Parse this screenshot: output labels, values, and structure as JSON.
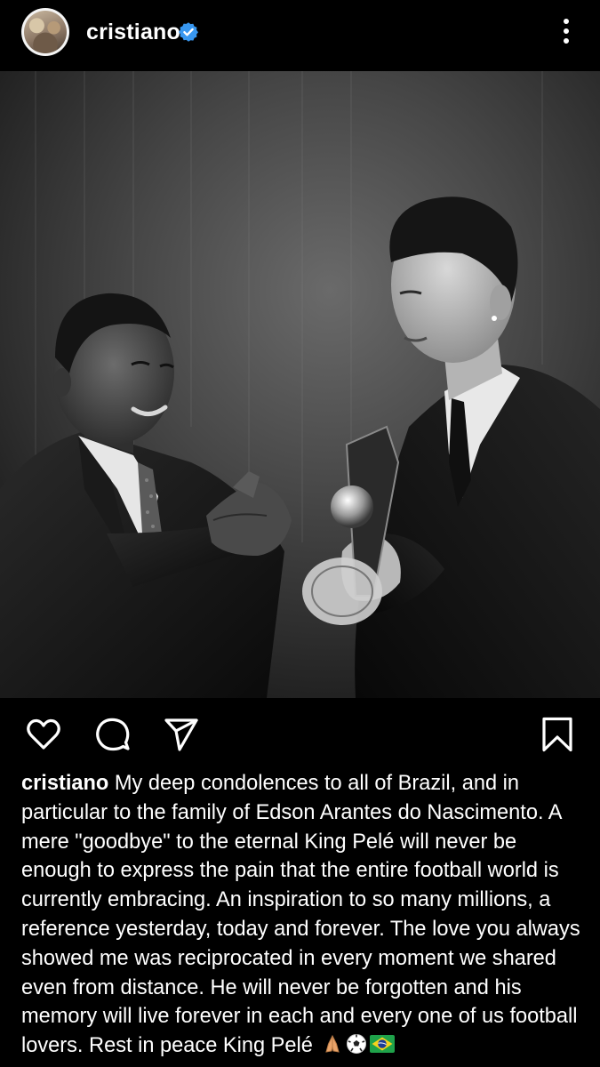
{
  "header": {
    "username": "cristiano",
    "verified_icon": "verified-badge-icon",
    "more_icon": "more-vertical-icon"
  },
  "actions": {
    "like_icon": "heart-icon",
    "comment_icon": "comment-icon",
    "share_icon": "send-icon",
    "save_icon": "bookmark-icon"
  },
  "caption": {
    "username": "cristiano",
    "text": "My deep condolences to all of Brazil, and in particular to the family of Edson Arantes do Nascimento. A mere \"goodbye\" to the eternal King Pelé will never be enough to express the pain that the entire football world is currently embracing. An inspiration to so many millions, a reference yesterday, today and forever. The love you always showed me was reciprocated in every moment we shared even from distance. He will never be forgotten and his memory will live forever in each and every one of us football lovers. Rest in peace King Pelé",
    "emojis": [
      "folded-hands-icon",
      "soccer-ball-icon",
      "brazil-flag-icon"
    ]
  },
  "colors": {
    "background": "#000000",
    "text": "#ffffff",
    "verified_blue": "#3897f0"
  }
}
